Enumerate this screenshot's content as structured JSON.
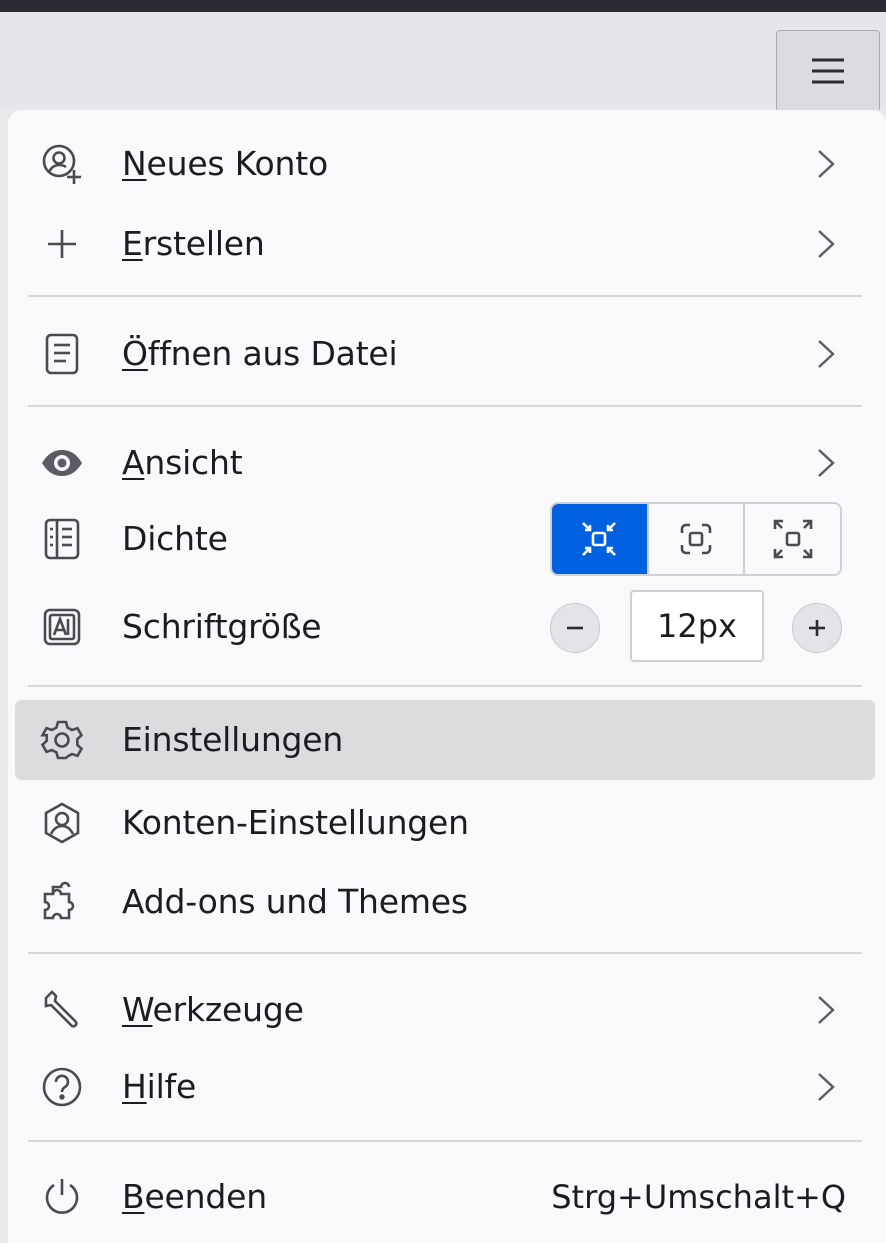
{
  "menu_button": {
    "icon": "hamburger-icon"
  },
  "menu": {
    "new_account": {
      "label_first": "N",
      "label_rest": "eues Konto",
      "icon": "account-add-icon"
    },
    "create": {
      "label_first": "E",
      "label_rest": "rstellen",
      "icon": "plus-icon"
    },
    "open_file": {
      "label_first": "Ö",
      "label_rest": "ffnen aus Datei",
      "icon": "file-icon"
    },
    "view": {
      "label_first": "A",
      "label_rest": "nsicht",
      "icon": "eye-icon"
    },
    "density": {
      "label": "Dichte",
      "icon": "density-icon",
      "options": [
        "compact",
        "normal",
        "touch"
      ],
      "selected": "compact"
    },
    "font_size": {
      "label": "Schriftgröße",
      "icon": "font-size-icon",
      "value": "12px",
      "decrease_icon": "minus-icon",
      "increase_icon": "plus-icon"
    },
    "settings": {
      "label": "Einstellungen",
      "icon": "gear-icon",
      "highlighted": true
    },
    "account_settings": {
      "label": "Konten-Einstellungen",
      "icon": "account-settings-icon"
    },
    "addons": {
      "label": "Add-ons und Themes",
      "icon": "puzzle-icon"
    },
    "tools": {
      "label_first": "W",
      "label_rest": "erkzeuge",
      "icon": "wrench-icon"
    },
    "help": {
      "label_first": "H",
      "label_rest": "ilfe",
      "icon": "help-icon"
    },
    "quit": {
      "label_first": "B",
      "label_rest": "eenden",
      "icon": "power-icon",
      "shortcut": "Strg+Umschalt+Q"
    }
  },
  "colors": {
    "accent": "#0061e0",
    "panel": "#f9f9fb",
    "highlight": "#dcdcdf",
    "separator": "#d7d7db"
  }
}
